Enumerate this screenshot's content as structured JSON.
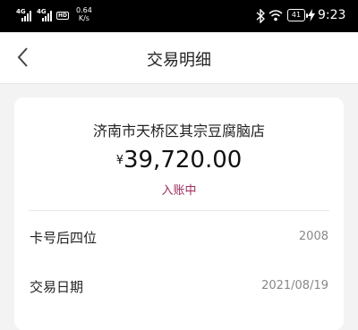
{
  "status_bar": {
    "sim1": "4G",
    "sim2": "4G",
    "hd": "HD",
    "speed_value": "0.64",
    "speed_unit": "K/s",
    "battery": "41",
    "time": "9:23"
  },
  "header": {
    "title": "交易明细"
  },
  "transaction": {
    "merchant": "济南市天桥区其宗豆腐脑店",
    "currency_symbol": "¥",
    "amount": "39,720.00",
    "status": "入账中",
    "status_color": "#a02b5c",
    "details": [
      {
        "label": "卡号后四位",
        "value": "2008"
      },
      {
        "label": "交易日期",
        "value": "2021/08/19"
      }
    ]
  }
}
